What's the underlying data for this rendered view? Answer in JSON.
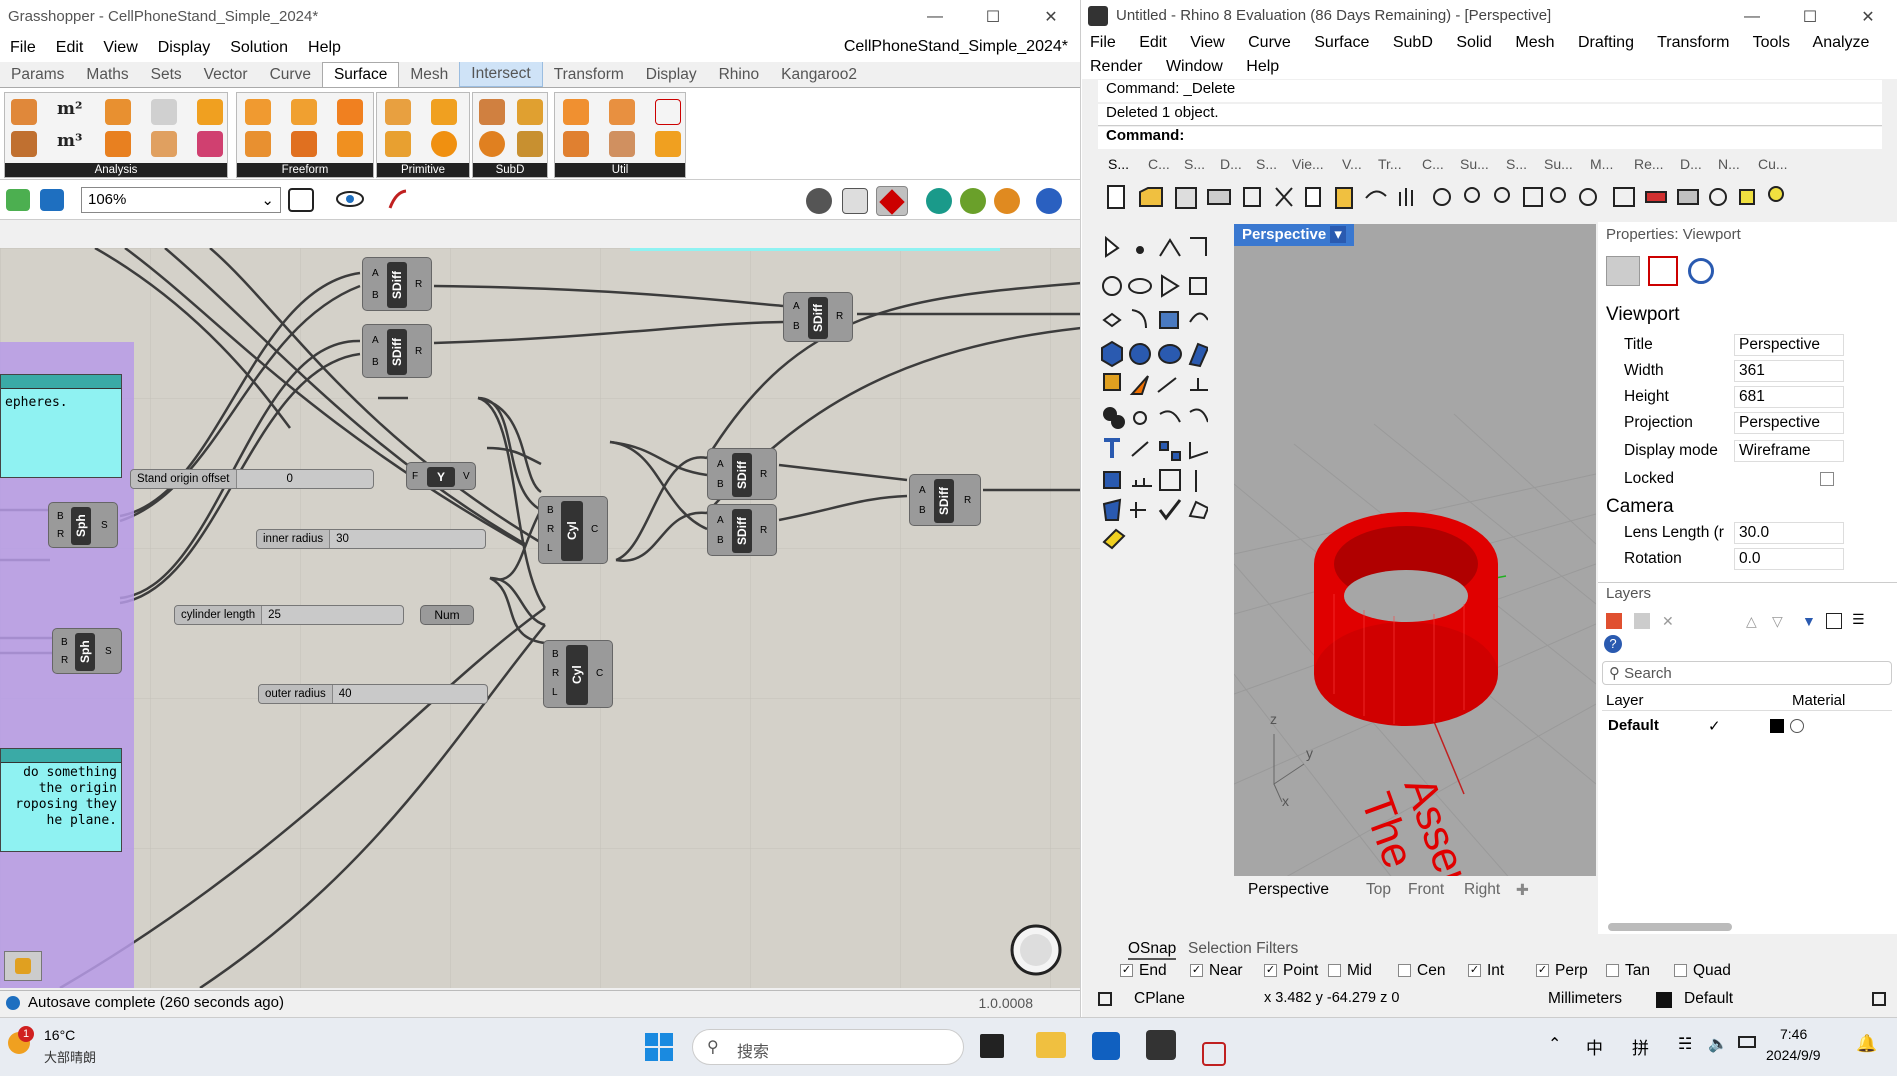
{
  "gh": {
    "title": "Grasshopper - CellPhoneStand_Simple_2024*",
    "doc_name": "CellPhoneStand_Simple_2024*",
    "menu": [
      "File",
      "Edit",
      "View",
      "Display",
      "Solution",
      "Help"
    ],
    "tabs": [
      "Params",
      "Maths",
      "Sets",
      "Vector",
      "Curve",
      "Surface",
      "Mesh",
      "Intersect",
      "Transform",
      "Display",
      "Rhino",
      "Kangaroo2"
    ],
    "groups": [
      "Analysis",
      "Freeform",
      "Primitive",
      "SubD",
      "Util"
    ],
    "zoom": "106%",
    "status_text": "Autosave complete (260 seconds ago)",
    "version": "1.0.0008",
    "sliders": {
      "stand_origin": {
        "name": "Stand origin offset",
        "value": "0"
      },
      "inner_radius": {
        "name": "inner radius",
        "value": "30"
      },
      "cyl_length": {
        "name": "cylinder length",
        "value": "25"
      },
      "outer_radius": {
        "name": "outer radius",
        "value": "40"
      }
    },
    "panels": {
      "p1": "epheres.",
      "p2": "do something\nthe origin\nroposing they\nhe plane."
    },
    "comp_labels": {
      "sdiff": "SDiff",
      "sph": "Sph",
      "cyl": "Cyl",
      "num": "Num",
      "expr": "Y",
      "in_a": "A",
      "in_b": "B",
      "out_r": "R",
      "in_r": "R",
      "out_s": "S",
      "in_l": "L",
      "out_c": "C",
      "in_f": "F",
      "out_v": "V"
    }
  },
  "rh": {
    "title": "Untitled - Rhino 8 Evaluation (86 Days Remaining) - [Perspective]",
    "menu_row1": [
      "File",
      "Edit",
      "View",
      "Curve",
      "Surface",
      "SubD",
      "Solid",
      "Mesh",
      "Drafting",
      "Transform",
      "Tools",
      "Analyze"
    ],
    "menu_row2": [
      "Render",
      "Window",
      "Help"
    ],
    "cmd_line1": "Command: _Delete",
    "cmd_line2": "Deleted 1 object.",
    "cmd_prompt": "Command:",
    "toolbar_tabs": [
      "S...",
      "C...",
      "S...",
      "D...",
      "S...",
      "Vie...",
      "V...",
      "Tr...",
      "C...",
      "Su...",
      "S...",
      "Su...",
      "M...",
      "Re...",
      "D...",
      "N...",
      "Cu..."
    ],
    "viewport_label": "Perspective",
    "viewport_tabs": [
      "Perspective",
      "Top",
      "Front",
      "Right"
    ],
    "viewport_text": "Asser\nThe",
    "axis_z": "z",
    "axis_y": "y",
    "axis_x": "x",
    "props_title": "Properties: Viewport",
    "viewport_section": "Viewport",
    "camera_section": "Camera",
    "props": [
      {
        "label": "Title",
        "value": "Perspective"
      },
      {
        "label": "Width",
        "value": "361"
      },
      {
        "label": "Height",
        "value": "681"
      },
      {
        "label": "Projection",
        "value": "Perspective"
      },
      {
        "label": "Display mode",
        "value": "Wireframe"
      },
      {
        "label": "Locked",
        "value": ""
      }
    ],
    "camera_props": [
      {
        "label": "Lens Length (r",
        "value": "30.0"
      },
      {
        "label": "Rotation",
        "value": "0.0"
      }
    ],
    "layers_title": "Layers",
    "search_placeholder": "Search",
    "layer_col": "Layer",
    "material_col": "Material",
    "layer_name": "Default",
    "osnap_tabs": [
      "OSnap",
      "Selection Filters"
    ],
    "osnap_items": [
      {
        "label": "End",
        "checked": true
      },
      {
        "label": "Near",
        "checked": true
      },
      {
        "label": "Point",
        "checked": true
      },
      {
        "label": "Mid",
        "checked": false
      },
      {
        "label": "Cen",
        "checked": false
      },
      {
        "label": "Int",
        "checked": true
      },
      {
        "label": "Perp",
        "checked": true
      },
      {
        "label": "Tan",
        "checked": false
      },
      {
        "label": "Quad",
        "checked": false
      }
    ],
    "status_cplane": "CPlane",
    "status_coords": "x 3.482  y -64.279  z 0",
    "status_units": "Millimeters",
    "status_layer": "Default"
  },
  "taskbar": {
    "weather_temp": "16°C",
    "weather_desc": "大部晴朗",
    "weather_badge": "1",
    "search_text": "搜索",
    "ime1": "中",
    "ime2": "拼",
    "time": "7:46",
    "date": "2024/9/9"
  },
  "colors": {
    "accent": "#0078d4",
    "red": "#ff0000",
    "panel": "#8ff2f2",
    "group": "#b79be8"
  }
}
